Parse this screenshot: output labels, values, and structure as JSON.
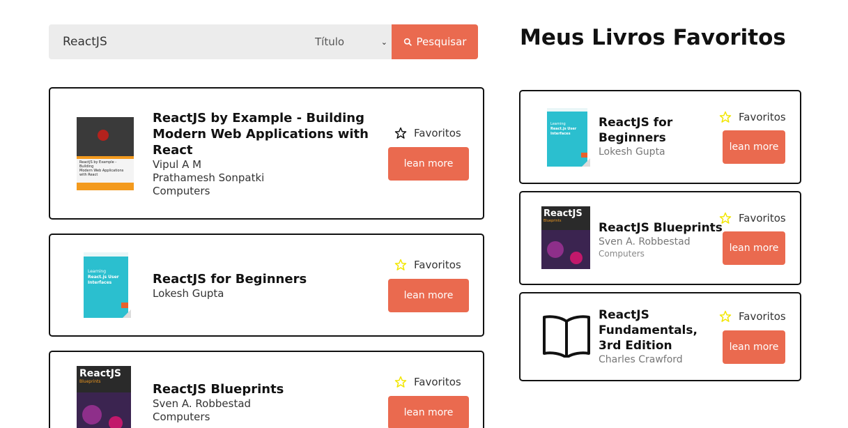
{
  "search": {
    "query": "ReactJS",
    "select_value": "Título",
    "button_label": "Pesquisar"
  },
  "favorites_heading": "Meus Livros Favoritos",
  "common": {
    "fav_label": "Favoritos",
    "learn_label": "lean more"
  },
  "colors": {
    "accent": "#ea6a4f",
    "star_filled": "#f2e600",
    "star_empty": "#111111"
  },
  "results": [
    {
      "title": "ReactJS by Example - Building Modern Web Applications with React",
      "authors": [
        "Vipul A M",
        "Prathamesh Sonpatki"
      ],
      "category": "Computers",
      "favorited": false,
      "cover_text": [
        "ReactJS by Example - Building",
        "Modern Web Applications",
        "with React"
      ]
    },
    {
      "title": "ReactJS for Beginners",
      "authors": [
        "Lokesh Gupta"
      ],
      "favorited": true,
      "cover_text": [
        "Learning",
        "React.js User",
        "Interfaces"
      ]
    },
    {
      "title": "ReactJS Blueprints",
      "authors": [
        "Sven A. Robbestad"
      ],
      "category": "Computers",
      "favorited": true,
      "cover_text": [
        "ReactJS",
        "Blueprints"
      ]
    }
  ],
  "favorites": [
    {
      "title": "ReactJS for Beginners",
      "authors": [
        "Lokesh Gupta"
      ],
      "cover_text": [
        "Learning",
        "React.js User",
        "Interfaces"
      ]
    },
    {
      "title": "ReactJS Blueprints",
      "authors": [
        "Sven A. Robbestad"
      ],
      "category": "Computers",
      "cover_text": [
        "ReactJS",
        "Blueprints"
      ]
    },
    {
      "title": "ReactJS Fundamentals, 3rd Edition",
      "authors": [
        "Charles Crawford"
      ],
      "cover_icon": "open-book-icon"
    }
  ]
}
